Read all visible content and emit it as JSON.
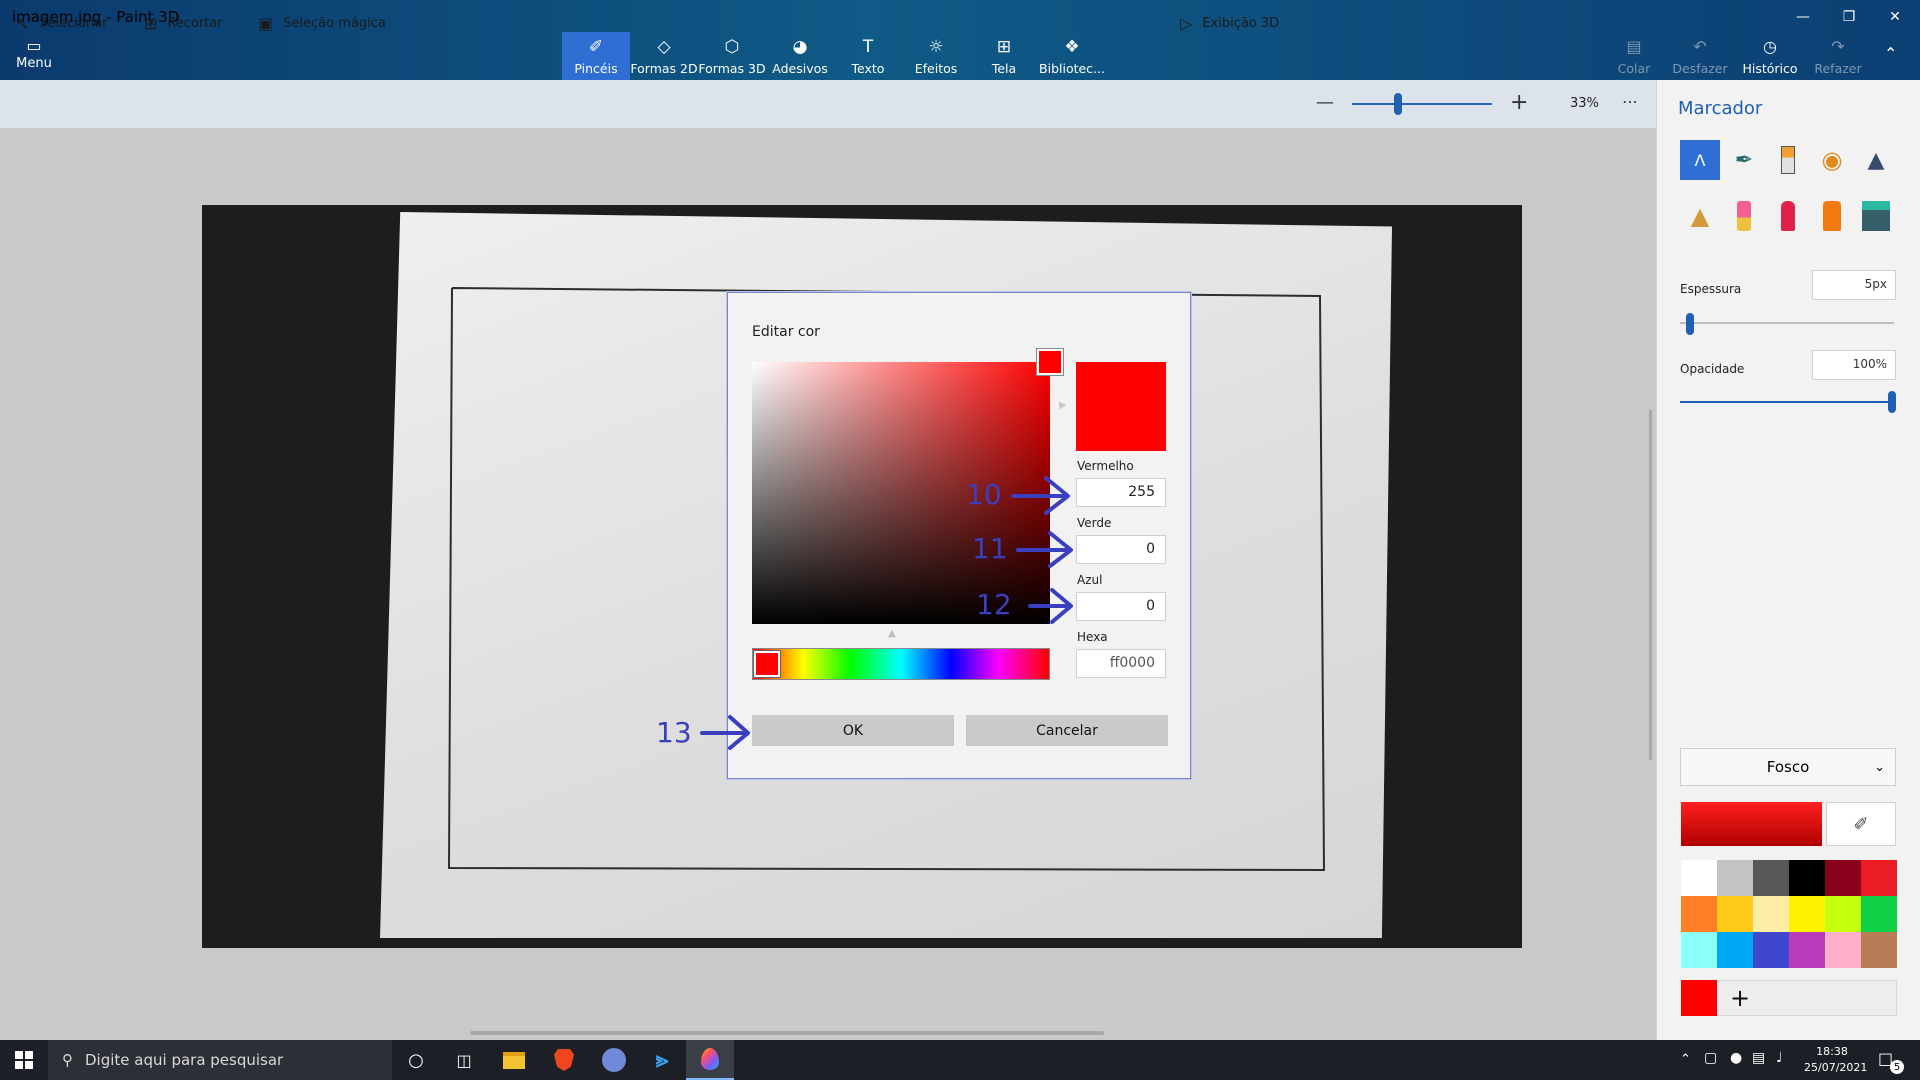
{
  "window": {
    "title": "imagem.jpg - Paint 3D"
  },
  "ribbon": {
    "menu_label": "Menu",
    "tools": [
      "Pincéis",
      "Formas 2D",
      "Formas 3D",
      "Adesivos",
      "Texto",
      "Efeitos",
      "Tela",
      "Bibliotec..."
    ],
    "right_tools": [
      "Colar",
      "Desfazer",
      "Histórico",
      "Refazer"
    ]
  },
  "toolbar": {
    "select": "Selecionar",
    "crop": "Recortar",
    "magic_select": "Seleção mágica",
    "view3d": "Exibição 3D",
    "zoom": "33%",
    "zoom_level": 0.33
  },
  "panel": {
    "title": "Marcador",
    "thickness_label": "Espessura",
    "thickness_value": "5px",
    "opacity_label": "Opacidade",
    "opacity_value": "100%",
    "finish": "Fosco",
    "current_color": "#ff0000",
    "palette": [
      "#ffffff",
      "#c3c3c3",
      "#585858",
      "#000000",
      "#88001b",
      "#ec1c24",
      "#ff7f27",
      "#ffca18",
      "#fdeca6",
      "#fff200",
      "#c4ff0e",
      "#0ed145",
      "#8cfffb",
      "#00a8f3",
      "#3f48cc",
      "#b83dba",
      "#ffaec8",
      "#b97a56"
    ]
  },
  "dialog": {
    "title": "Editar cor",
    "red_label": "Vermelho",
    "red": "255",
    "green_label": "Verde",
    "green": "0",
    "blue_label": "Azul",
    "blue": "0",
    "hex_label": "Hexa",
    "hex": "ff0000",
    "ok": "OK",
    "cancel": "Cancelar"
  },
  "annotations": [
    "10",
    "11",
    "12",
    "13"
  ],
  "taskbar": {
    "search_placeholder": "Digite aqui para pesquisar",
    "time": "18:38",
    "date": "25/07/2021",
    "notification_count": "5"
  }
}
